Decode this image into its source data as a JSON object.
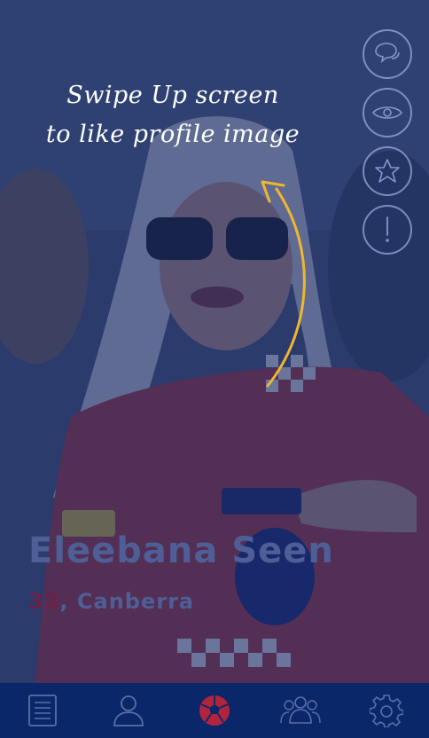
{
  "hint": {
    "line1": "Swipe Up screen",
    "line2": "to like profile image"
  },
  "profile": {
    "name": "Eleebana Seen",
    "age": "33",
    "separator": ", ",
    "city": "Canberra"
  },
  "actions": [
    {
      "icon": "chat-bubbles-icon"
    },
    {
      "icon": "eye-icon"
    },
    {
      "icon": "star-icon"
    },
    {
      "icon": "exclamation-icon"
    }
  ],
  "tabs": [
    {
      "icon": "document-icon"
    },
    {
      "icon": "person-icon"
    },
    {
      "icon": "soccer-ball-icon",
      "active": true
    },
    {
      "icon": "people-group-icon"
    },
    {
      "icon": "gear-icon"
    }
  ],
  "colors": {
    "overlay": "#162866",
    "tabbar": "#0a2769",
    "icon_inactive": "#5a6fa8",
    "icon_active": "#b0243d",
    "hint_arrow": "#f0b630",
    "name_text": "#4d5f96",
    "age_text": "#6d2148"
  }
}
